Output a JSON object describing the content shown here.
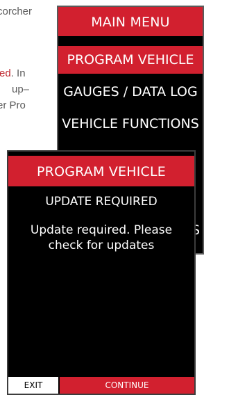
{
  "background_text": {
    "line1": "corcher",
    "line2_red": "red",
    "line2_rest": ". In",
    "line3": "up–",
    "line4": "er Pro"
  },
  "main_menu": {
    "title": "MAIN MENU",
    "items": [
      {
        "label": "PROGRAM VEHICLE",
        "selected": true
      },
      {
        "label": "GAUGES / DATA LOG",
        "selected": false
      },
      {
        "label": "VEHICLE FUNCTIONS",
        "selected": false
      }
    ],
    "peek_text": "S"
  },
  "dialog": {
    "title": "PROGRAM VEHICLE",
    "heading": "UPDATE REQUIRED",
    "message": "Update required. Please check for updates",
    "exit_label": "EXIT",
    "continue_label": "CONTINUE"
  },
  "colors": {
    "accent_red": "#d2202f",
    "screen_black": "#000000",
    "body_gray": "#5b5b5b"
  }
}
